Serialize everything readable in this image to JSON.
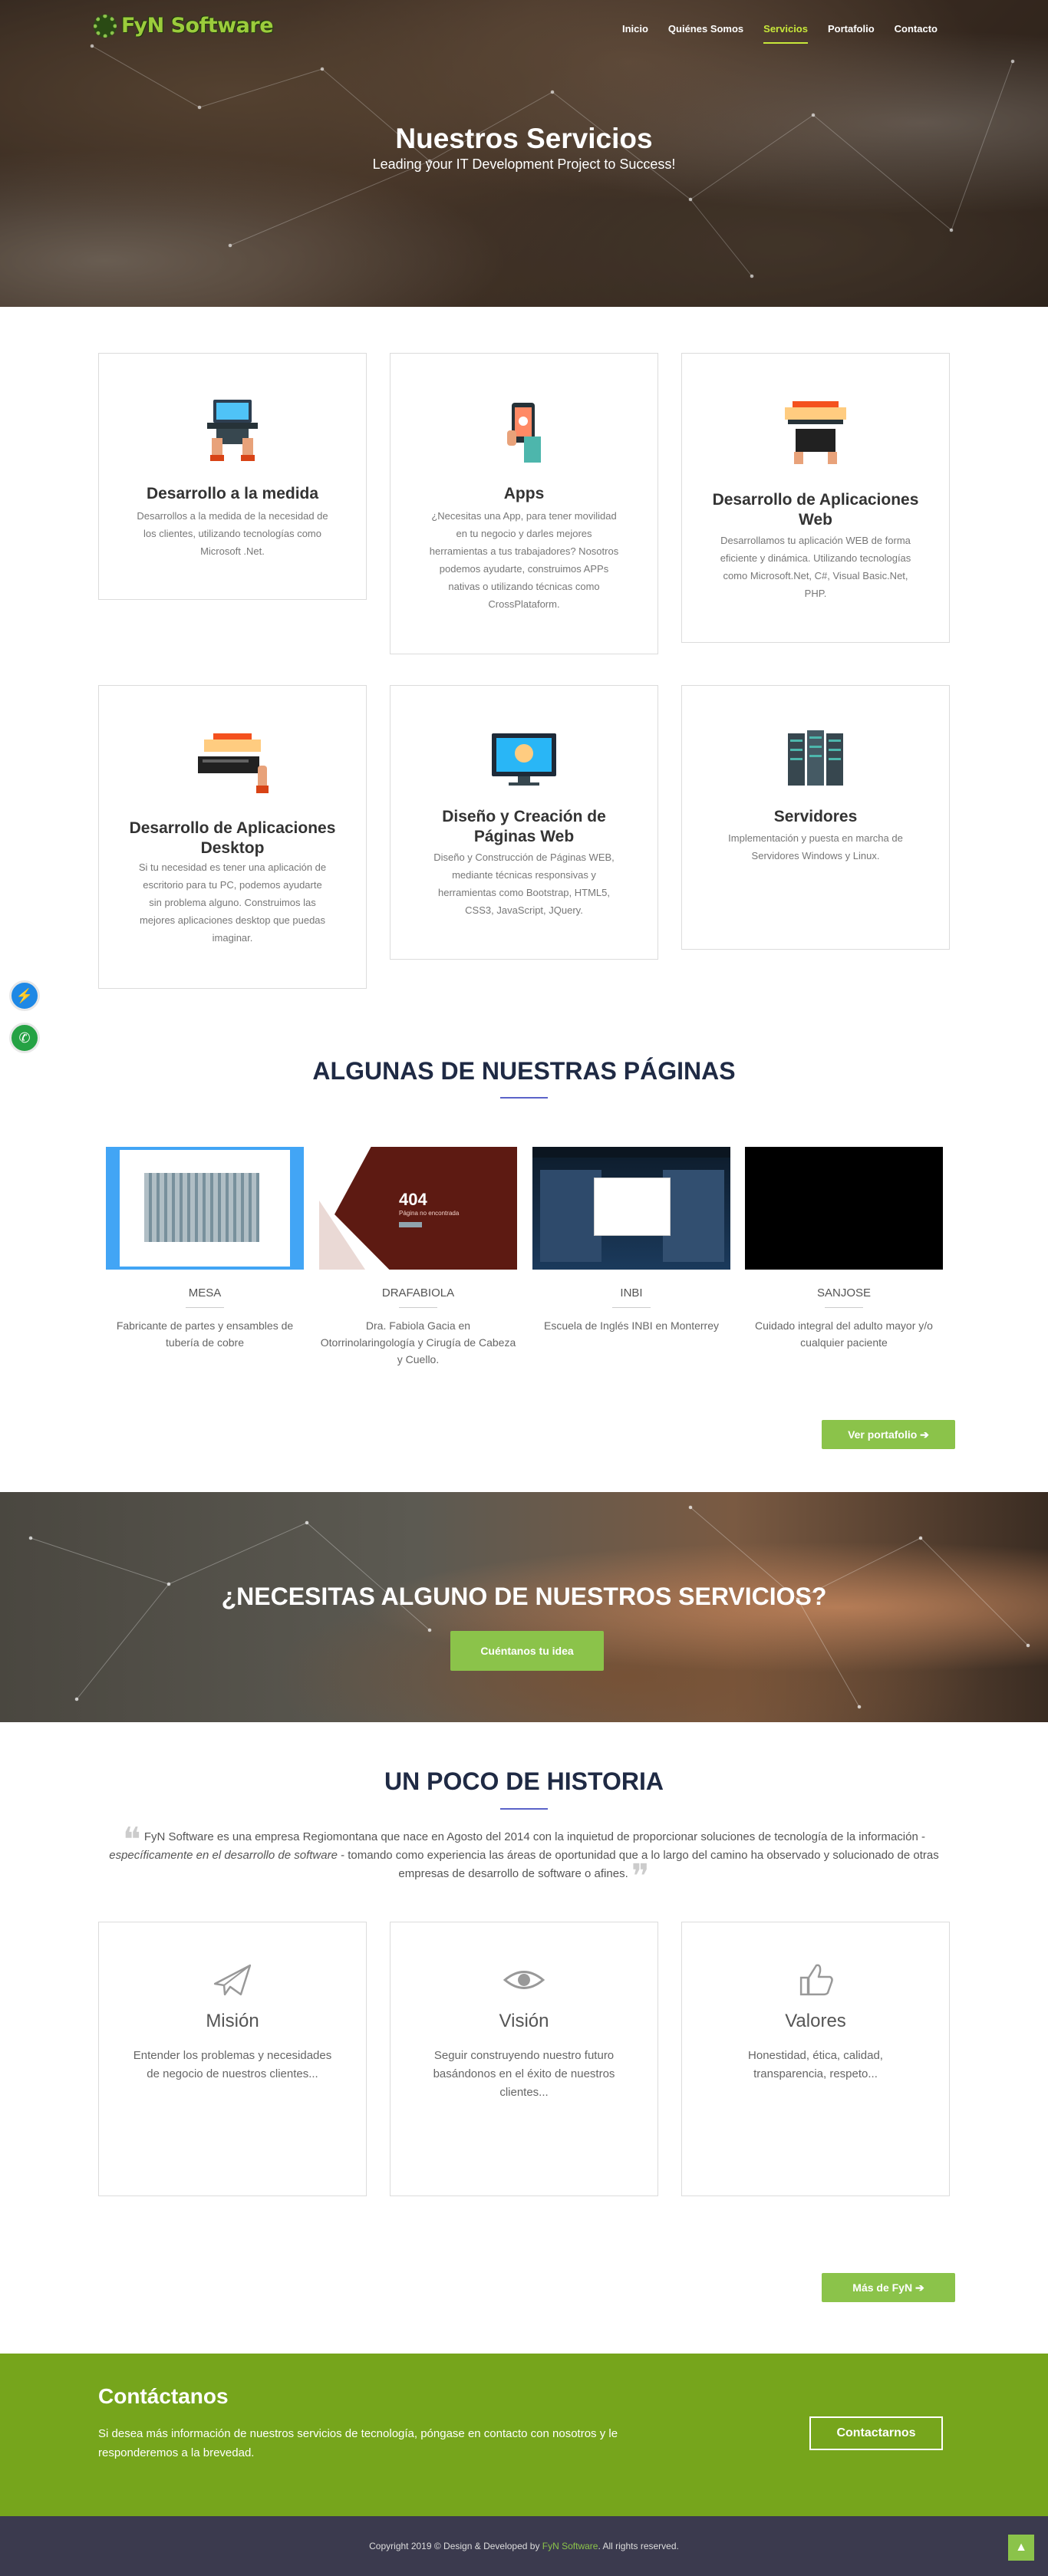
{
  "brand": {
    "name": "FyN Software"
  },
  "nav": [
    {
      "label": "Inicio",
      "active": false
    },
    {
      "label": "Quiénes Somos",
      "active": false
    },
    {
      "label": "Servicios",
      "active": true
    },
    {
      "label": "Portafolio",
      "active": false
    },
    {
      "label": "Contacto",
      "active": false
    }
  ],
  "hero": {
    "title": "Nuestros Servicios",
    "subtitle": "Leading your IT Development Project to Success!"
  },
  "services": [
    {
      "title": "Desarrollo a la medida",
      "text": "Desarrollos a la medida de la necesidad de los clientes, utilizando tecnologías como Microsoft .Net."
    },
    {
      "title": "Apps",
      "text": "¿Necesitas una App, para tener movilidad en tu negocio y darles mejores herramientas a tus trabajadores? Nosotros podemos ayudarte, construimos APPs nativas o utilizando técnicas como CrossPlataform."
    },
    {
      "title": "Desarrollo de Aplicaciones Web",
      "text": "Desarrollamos tu aplicación WEB de forma eficiente y dinámica. Utilizando tecnologías como Microsoft.Net, C#, Visual Basic.Net, PHP."
    },
    {
      "title": "Desarrollo de Aplicaciones Desktop",
      "text": "Si tu necesidad es tener una aplicación de escritorio para tu PC, podemos ayudarte sin problema alguno. Construimos las mejores aplicaciones desktop que puedas imaginar."
    },
    {
      "title": "Diseño y Creación de Páginas Web",
      "text": "Diseño y Construcción de Páginas WEB, mediante técnicas responsivas y herramientas como Bootstrap, HTML5, CSS3, JavaScript, JQuery."
    },
    {
      "title": "Servidores",
      "text": "Implementación y puesta en marcha de Servidores Windows y Linux."
    }
  ],
  "pages_section": {
    "title": "ALGUNAS DE NUESTRAS PÁGINAS",
    "items": [
      {
        "name": "MESA",
        "desc": "Fabricante de partes y ensambles de tubería de cobre"
      },
      {
        "name": "DRAFABIOLA",
        "desc": "Dra. Fabiola Gacia en Otorrinolaringología y Cirugía de Cabeza y Cuello."
      },
      {
        "name": "INBI",
        "desc": "Escuela de Inglés INBI en Monterrey"
      },
      {
        "name": "SANJOSE",
        "desc": "Cuidado integral del adulto mayor y/o cualquier paciente"
      }
    ],
    "thumb_404": "404",
    "thumb_404_sub": "Página no encontrada",
    "button": "Ver portafolio ➔"
  },
  "cta": {
    "title": "¿NECESITAS ALGUNO DE NUESTROS SERVICIOS?",
    "button": "Cuéntanos tu idea"
  },
  "history": {
    "title": "UN POCO DE HISTORIA",
    "text_a": "FyN Software es una empresa Regiomontana que nace en Agosto del 2014 con la inquietud de proporcionar soluciones de tecnología de la información - ",
    "text_em": "específicamente en el desarrollo de software",
    "text_b": " - tomando como experiencia las áreas de oportunidad que a lo largo del camino ha observado y solucionado de otras empresas de desarrollo de software o afines.",
    "cards": [
      {
        "title": "Misión",
        "text": "Entender los problemas y necesidades de negocio de nuestros clientes..."
      },
      {
        "title": "Visión",
        "text": "Seguir construyendo nuestro futuro basándonos en el éxito de nuestros clientes..."
      },
      {
        "title": "Valores",
        "text": "Honestidad, ética, calidad, transparencia, respeto..."
      }
    ],
    "button": "Más de FyN ➔"
  },
  "contact": {
    "title": "Contáctanos",
    "text": "Si desea más información de nuestros servicios de tecnología, póngase en contacto con nosotros y le responderemos a la brevedad.",
    "button": "Contactarnos"
  },
  "footer": {
    "copy_a": "Copyright 2019 © Design & Developed by ",
    "brand": "FyN Software",
    "copy_b": ". All rights reserved."
  },
  "colors": {
    "accent": "#8bc34a",
    "nav_active": "#c7e83a",
    "heading": "#1f2a44",
    "contact_bg": "#76a51c",
    "footer_bg": "#3b3a4e"
  }
}
